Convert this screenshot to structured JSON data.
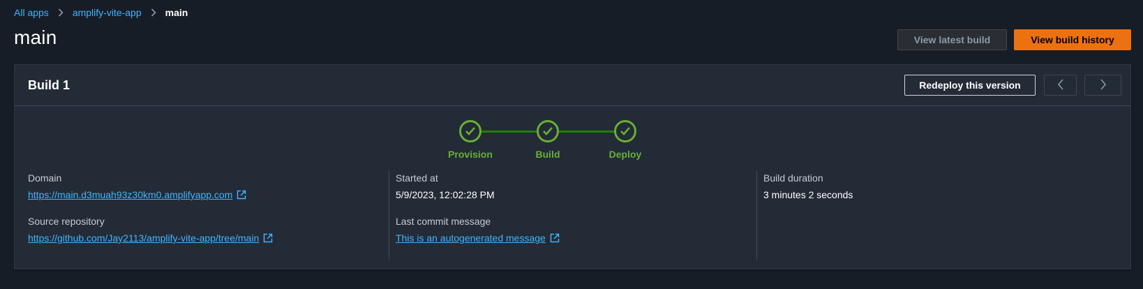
{
  "breadcrumb": {
    "items": [
      "All apps",
      "amplify-vite-app"
    ],
    "current": "main"
  },
  "page": {
    "title": "main",
    "view_latest_build_label": "View latest build",
    "view_build_history_label": "View build history"
  },
  "build": {
    "title": "Build 1",
    "redeploy_label": "Redeploy this version",
    "steps": [
      {
        "label": "Provision",
        "status": "succeeded"
      },
      {
        "label": "Build",
        "status": "succeeded"
      },
      {
        "label": "Deploy",
        "status": "succeeded"
      }
    ],
    "details": {
      "domain_label": "Domain",
      "domain_value": "https://main.d3muah93z30km0.amplifyapp.com",
      "source_repository_label": "Source repository",
      "source_repository_value": "https://github.com/Jay2113/amplify-vite-app/tree/main",
      "started_at_label": "Started at",
      "started_at_value": "5/9/2023, 12:02:28 PM",
      "last_commit_label": "Last commit message",
      "last_commit_value": "This is an autogenerated message",
      "duration_label": "Build duration",
      "duration_value": "3 minutes 2 seconds"
    }
  },
  "colors": {
    "background": "#161d26",
    "card": "#232b37",
    "link": "#42b4ff",
    "primary_button": "#ec7211",
    "success": "#6aaf35",
    "success_line": "#1d8102"
  },
  "icons": [
    "chevron-right-icon",
    "chevron-left-icon",
    "check-icon",
    "external-link-icon"
  ]
}
